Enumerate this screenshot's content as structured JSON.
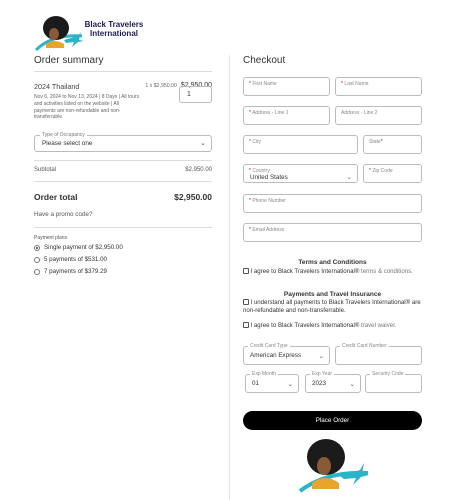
{
  "brand": {
    "name_line1": "Black Travelers",
    "name_line2": "International",
    "colors": {
      "navy": "#1c1c55",
      "teal": "#2bb3c8",
      "gold": "#e8a52c"
    }
  },
  "order_summary": {
    "heading": "Order summary",
    "item": {
      "name": "2024 Thailand",
      "qty_price": "1 x $2,950.00",
      "price": "$2,950.00",
      "description": "Nov 6, 2024 to Nov 13, 2024 | 8 Days | All tours and activities listed on the website | All payments are non-refundable and non-transferrable.",
      "quantity": "1"
    },
    "occupancy": {
      "label": "Type of Occupancy",
      "value": "Please select one"
    },
    "subtotal_label": "Subtotal",
    "subtotal_value": "$2,950.00",
    "total_label": "Order total",
    "total_value": "$2,950.00",
    "promo": "Have a promo code?",
    "payment_plans_label": "Payment plans",
    "payment_plans": [
      {
        "label": "Single payment of $2,950.00",
        "selected": true
      },
      {
        "label": "5 payments of $531.00",
        "selected": false
      },
      {
        "label": "7 payments of $379.29",
        "selected": false
      }
    ]
  },
  "checkout": {
    "heading": "Checkout",
    "fields": {
      "first_name": "First Name",
      "last_name": "Last Name",
      "address1": "Address - Line 1",
      "address2": "Address - Line 2",
      "city": "City",
      "state": "State",
      "country_label": "Country",
      "country_value": "United States",
      "zip": "Zip Code",
      "phone": "Phone Number",
      "email": "Email Address"
    },
    "terms_title": "Terms and Conditions",
    "terms_text_main": "I agree to Black Travelers International® ",
    "terms_text_muted": "terms & conditions.",
    "payments_title": "Payments and Travel Insurance",
    "payments_text": "I understand all payments to Black Travelers International® are non-refundable and non-transferrable.",
    "waiver_text_main": "I agree to Black Travelers International® ",
    "waiver_text_muted": "travel waiver.",
    "card_type_label": "Credit Card Type",
    "card_type_value": "American Express",
    "card_number_label": "Credit Card Number",
    "exp_month_label": "Exp Month",
    "exp_month_value": "01",
    "exp_year_label": "Exp Year",
    "exp_year_value": "2023",
    "security_code_label": "Security Code",
    "place_order": "Place Order"
  },
  "icons": [
    "chevron-down-icon",
    "radio-icon",
    "checkbox-icon",
    "airplane-icon"
  ]
}
